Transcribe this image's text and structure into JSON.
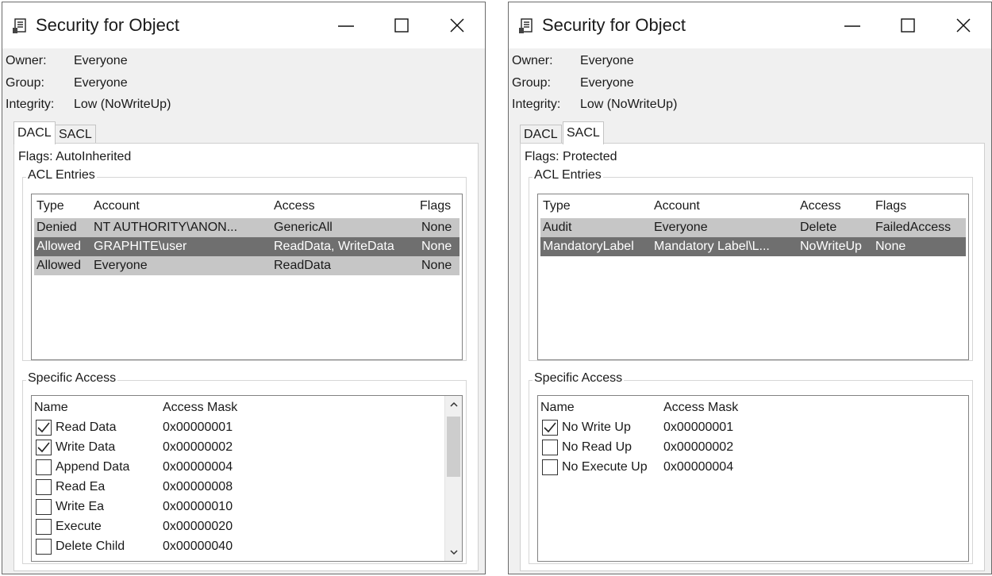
{
  "left_window": {
    "title": "Security for Object",
    "owner_label": "Owner:",
    "owner_value": "Everyone",
    "group_label": "Group:",
    "group_value": "Everyone",
    "integrity_label": "Integrity:",
    "integrity_value": "Low (NoWriteUp)",
    "tabs": [
      {
        "label": "DACL",
        "active": true
      },
      {
        "label": "SACL",
        "active": false
      }
    ],
    "flags_text": "Flags: AutoInherited",
    "acl_legend": "ACL Entries",
    "acl_columns": [
      "Type",
      "Account",
      "Access",
      "Flags"
    ],
    "acl_rows": [
      {
        "type": "Denied",
        "account": "NT AUTHORITY\\ANON...",
        "access": "GenericAll",
        "flags": "None",
        "selected": false
      },
      {
        "type": "Allowed",
        "account": "GRAPHITE\\user",
        "access": "ReadData, WriteData",
        "flags": "None",
        "selected": true
      },
      {
        "type": "Allowed",
        "account": "Everyone",
        "access": "ReadData",
        "flags": "None",
        "selected": false
      }
    ],
    "specific_legend": "Specific Access",
    "specific_columns": [
      "Name",
      "Access Mask"
    ],
    "specific_rows": [
      {
        "name": "Read Data",
        "mask": "0x00000001",
        "checked": true
      },
      {
        "name": "Write Data",
        "mask": "0x00000002",
        "checked": true
      },
      {
        "name": "Append Data",
        "mask": "0x00000004",
        "checked": false
      },
      {
        "name": "Read Ea",
        "mask": "0x00000008",
        "checked": false
      },
      {
        "name": "Write Ea",
        "mask": "0x00000010",
        "checked": false
      },
      {
        "name": "Execute",
        "mask": "0x00000020",
        "checked": false
      },
      {
        "name": "Delete Child",
        "mask": "0x00000040",
        "checked": false
      }
    ]
  },
  "right_window": {
    "title": "Security for Object",
    "owner_label": "Owner:",
    "owner_value": "Everyone",
    "group_label": "Group:",
    "group_value": "Everyone",
    "integrity_label": "Integrity:",
    "integrity_value": "Low (NoWriteUp)",
    "tabs": [
      {
        "label": "DACL",
        "active": false
      },
      {
        "label": "SACL",
        "active": true
      }
    ],
    "flags_text": "Flags: Protected",
    "acl_legend": "ACL Entries",
    "acl_columns": [
      "Type",
      "Account",
      "Access",
      "Flags"
    ],
    "acl_rows": [
      {
        "type": "Audit",
        "account": "Everyone",
        "access": "Delete",
        "flags": "FailedAccess",
        "selected": false
      },
      {
        "type": "MandatoryLabel",
        "account": "Mandatory Label\\L...",
        "access": "NoWriteUp",
        "flags": "None",
        "selected": true
      }
    ],
    "specific_legend": "Specific Access",
    "specific_columns": [
      "Name",
      "Access Mask"
    ],
    "specific_rows": [
      {
        "name": "No Write Up",
        "mask": "0x00000001",
        "checked": true
      },
      {
        "name": "No Read Up",
        "mask": "0x00000002",
        "checked": false
      },
      {
        "name": "No Execute Up",
        "mask": "0x00000004",
        "checked": false
      }
    ]
  },
  "icons": {
    "app": "document-icon",
    "minimize": "minimize-icon",
    "maximize": "maximize-icon",
    "close": "close-icon",
    "check": "check-icon"
  },
  "colors": {
    "selected_row": "#6f6f6f",
    "unselected_row": "#c6c6c6",
    "window_bg": "#f0f0f0"
  }
}
